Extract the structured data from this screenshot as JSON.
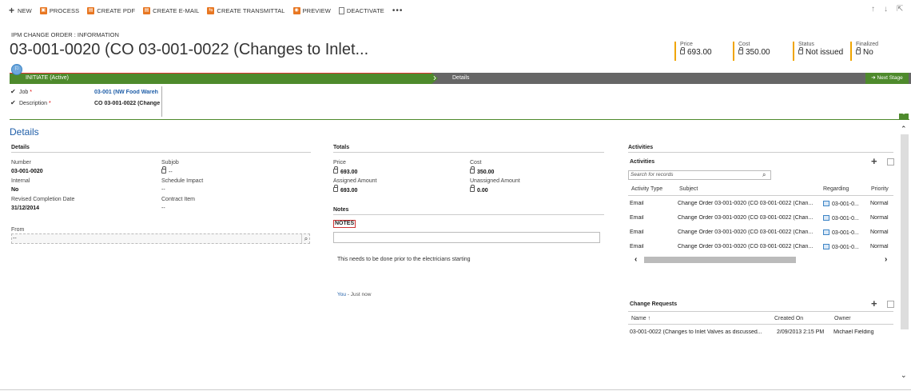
{
  "toolbar": {
    "new": "NEW",
    "process": "PROCESS",
    "create_pdf": "CREATE PDF",
    "create_email": "CREATE E-MAIL",
    "create_transmittal": "CREATE TRANSMITTAL",
    "preview": "PREVIEW",
    "deactivate": "DEACTIVATE",
    "more": "•••"
  },
  "header": {
    "entity_type": "IPM CHANGE ORDER : INFORMATION",
    "title": "03-001-0020 (CO 03-001-0022 (Changes to Inlet...",
    "fields": [
      {
        "label": "Price",
        "value": "693.00"
      },
      {
        "label": "Cost",
        "value": "350.00"
      },
      {
        "label": "Status",
        "value": "Not issued"
      },
      {
        "label": "Finalized",
        "value": "No"
      }
    ]
  },
  "process": {
    "active_stage": "INITIATE (Active)",
    "next_stage_label": "Details",
    "next_stage_button": "Next Stage",
    "fields": [
      {
        "label": "Job",
        "value": "03-001 (NW Food Wareh"
      },
      {
        "label": "Description",
        "value": "CO 03-001-0022 (Change"
      }
    ]
  },
  "details": {
    "heading": "Details",
    "section": "Details",
    "number_label": "Number",
    "number_value": "03-001-0020",
    "subjob_label": "Subjob",
    "subjob_value": "--",
    "internal_label": "Internal",
    "internal_value": "No",
    "schedule_label": "Schedule Impact",
    "schedule_value": "--",
    "revised_label": "Revised Completion Date",
    "revised_value": "31/12/2014",
    "contract_label": "Contract Item",
    "contract_value": "--",
    "from_label": "From",
    "from_value": "--"
  },
  "totals": {
    "section": "Totals",
    "price_label": "Price",
    "price_value": "693.00",
    "cost_label": "Cost",
    "cost_value": "350.00",
    "assigned_label": "Assigned Amount",
    "assigned_value": "693.00",
    "unassigned_label": "Unassigned Amount",
    "unassigned_value": "0.00"
  },
  "notes": {
    "section": "Notes",
    "tab": "NOTES",
    "text": "This needs to be done prior to the electricians starting",
    "author": "You",
    "separator": " - ",
    "time": "Just now"
  },
  "activities": {
    "section": "Activities",
    "grid_title": "Activities",
    "search_placeholder": "Search for records",
    "columns": [
      "Activity Type",
      "Subject",
      "Regarding",
      "Priority"
    ],
    "rows": [
      {
        "type": "Email",
        "subject": "Change Order 03-001-0020 (CO 03-001-0022 (Chan...",
        "regarding": "03-001-0...",
        "priority": "Normal"
      },
      {
        "type": "Email",
        "subject": "Change Order 03-001-0020 (CO 03-001-0022 (Chan...",
        "regarding": "03-001-0...",
        "priority": "Normal"
      },
      {
        "type": "Email",
        "subject": "Change Order 03-001-0020 (CO 03-001-0022 (Chan...",
        "regarding": "03-001-0...",
        "priority": "Normal"
      },
      {
        "type": "Email",
        "subject": "Change Order 03-001-0020 (CO 03-001-0022 (Chan...",
        "regarding": "03-001-0...",
        "priority": "Normal"
      }
    ]
  },
  "change_requests": {
    "title": "Change Requests",
    "columns": [
      "Name ↑",
      "Created On",
      "Owner"
    ],
    "rows": [
      {
        "name": "03-001-0022 (Changes to Inlet Valves as discussed...",
        "created_on": "2/09/2013 2:15 PM",
        "owner": "Michael Fielding"
      }
    ]
  },
  "colors": {
    "accent_green": "#4e8a2c",
    "link_blue": "#1f5ea8",
    "header_field_border": "#f0a500",
    "toolbar_icon": "#e87722"
  }
}
